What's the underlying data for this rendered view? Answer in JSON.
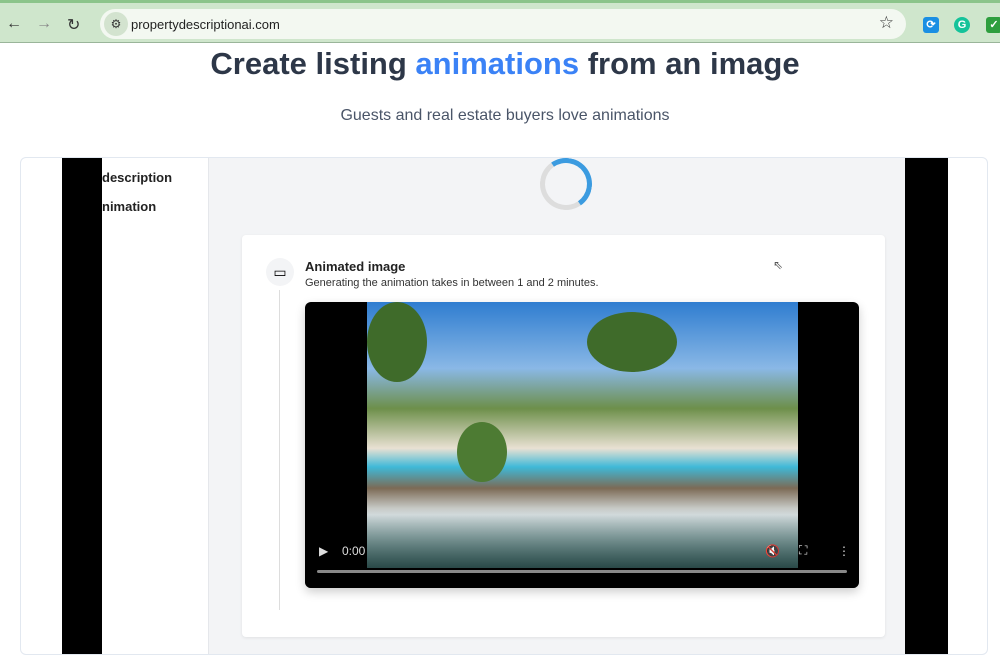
{
  "browser": {
    "url": "propertydescriptionai.com",
    "back": "←",
    "forward": "→",
    "reload": "↻"
  },
  "header": {
    "title_pre": "Create listing ",
    "title_highlight": "animations",
    "title_post": " from an image",
    "subtitle": "Guests and real estate buyers love animations"
  },
  "sidebar": {
    "items": [
      {
        "label": "description"
      },
      {
        "label": "nimation"
      }
    ]
  },
  "step": {
    "title": "Animated image",
    "description": "Generating the animation takes in between 1 and 2 minutes."
  },
  "video": {
    "time": "0:00",
    "progress": 0
  },
  "colors": {
    "accent": "#3b82f6",
    "heading": "#2d3748"
  }
}
